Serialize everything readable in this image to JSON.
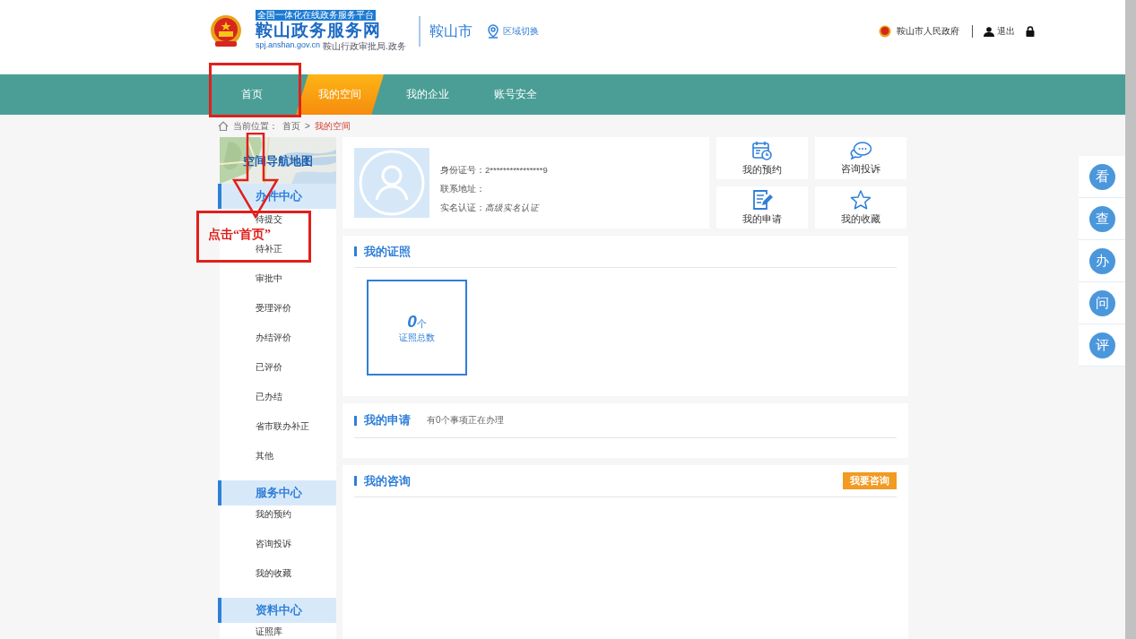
{
  "header": {
    "site_banner": "全国一体化在线政务服务平台",
    "site_name": "鞍山政务服务网",
    "site_domain": "spj.anshan.gov.cn",
    "site_sub": "鞍山行政审批局.政务",
    "city": "鞍山市",
    "region_switch": "区域切换",
    "gov_link": "鞍山市人民政府",
    "logout": "退出"
  },
  "nav": [
    {
      "label": "首页",
      "selected": false
    },
    {
      "label": "我的空间",
      "selected": true
    },
    {
      "label": "我的企业",
      "selected": false
    },
    {
      "label": "账号安全",
      "selected": false
    }
  ],
  "breadcrumb": {
    "prefix": "当前位置：",
    "items": [
      "首页",
      "我的空间"
    ],
    "separator": ">"
  },
  "sidebar": {
    "map_title": "空间导航地图",
    "sections": [
      {
        "title": "办件中心",
        "items": [
          "待提交",
          "待补正",
          "审批中",
          "受理评价",
          "办结评价",
          "已评价",
          "已办结",
          "省市联办补正",
          "其他"
        ]
      },
      {
        "title": "服务中心",
        "items": [
          "我的预约",
          "咨询投诉",
          "我的收藏"
        ]
      },
      {
        "title": "资料中心",
        "items": [
          "证照库"
        ]
      }
    ]
  },
  "profile": {
    "fields": [
      {
        "label": "身份证号：",
        "value": "2****************9",
        "italic": false
      },
      {
        "label": "联系地址："
      },
      {
        "label": "实名认证：",
        "value": "高级实名认证",
        "italic": true
      }
    ]
  },
  "quick_links": [
    {
      "label": "我的预约",
      "kind": "calendar"
    },
    {
      "label": "咨询投诉",
      "kind": "chat"
    },
    {
      "label": "我的申请",
      "kind": "form"
    },
    {
      "label": "我的收藏",
      "kind": "star"
    }
  ],
  "licenses": {
    "title": "我的证照",
    "count": "0",
    "unit": "个",
    "caption": "证照总数"
  },
  "applications": {
    "title": "我的申请",
    "note": "有0个事项正在办理"
  },
  "consultations": {
    "title": "我的咨询",
    "button": "我要咨询"
  },
  "float_bar": [
    "看",
    "查",
    "办",
    "问",
    "评"
  ],
  "annotation": {
    "text": "点击“首页”"
  }
}
